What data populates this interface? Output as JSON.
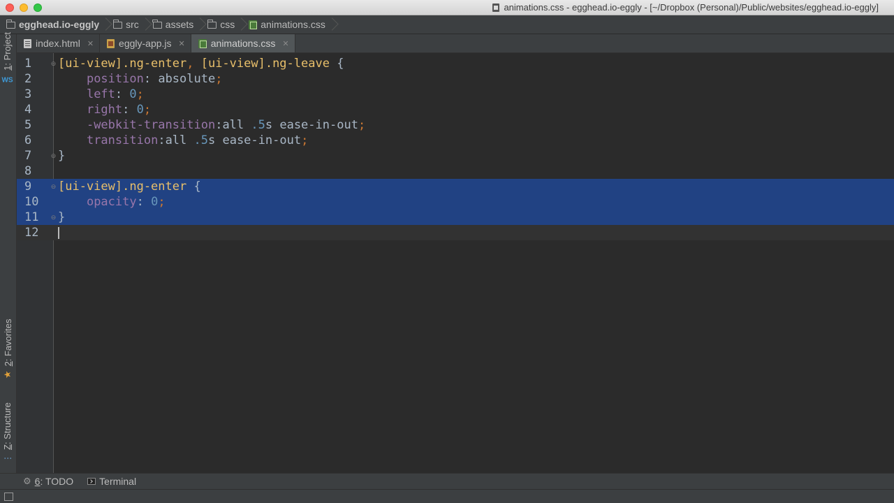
{
  "window": {
    "title": "animations.css - egghead.io-eggly - [~/Dropbox (Personal)/Public/websites/egghead.io-eggly]"
  },
  "breadcrumb": {
    "items": [
      {
        "label": "egghead.io-eggly",
        "icon": "folder-icon"
      },
      {
        "label": "src",
        "icon": "folder-icon"
      },
      {
        "label": "assets",
        "icon": "folder-icon"
      },
      {
        "label": "css",
        "icon": "folder-icon"
      },
      {
        "label": "animations.css",
        "icon": "css-file-icon"
      }
    ]
  },
  "side_tabs": {
    "project": {
      "num": "1",
      "label": ": Project"
    },
    "favorites": {
      "num": "2",
      "label": ": Favorites"
    },
    "structure": {
      "num": "Z",
      "label": ": Structure"
    }
  },
  "editor_tabs": [
    {
      "label": "index.html",
      "icon": "html-file-icon",
      "active": false
    },
    {
      "label": "eggly-app.js",
      "icon": "js-file-icon",
      "active": false
    },
    {
      "label": "animations.css",
      "icon": "css-file-icon",
      "active": true
    }
  ],
  "editor": {
    "line_numbers": [
      "1",
      "2",
      "3",
      "4",
      "5",
      "6",
      "7",
      "8",
      "9",
      "10",
      "11",
      "12"
    ],
    "selected_lines": [
      9,
      10,
      11
    ],
    "caret_line": 12,
    "code_lines": [
      "[ui-view].ng-enter, [ui-view].ng-leave {",
      "    position: absolute;",
      "    left: 0;",
      "    right: 0;",
      "    -webkit-transition:all .5s ease-in-out;",
      "    transition:all .5s ease-in-out;",
      "}",
      "",
      "[ui-view].ng-enter {",
      "    opacity: 0;",
      "}",
      ""
    ]
  },
  "bottom_tabs": {
    "todo": {
      "num": "6",
      "label": ": TODO"
    },
    "terminal": {
      "label": "Terminal"
    }
  },
  "colors": {
    "editor_bg": "#2b2b2b",
    "selection": "#214283",
    "selector": "#e8bf6a",
    "property": "#9876aa",
    "number": "#6897bb",
    "punctuation": "#cc7832"
  }
}
